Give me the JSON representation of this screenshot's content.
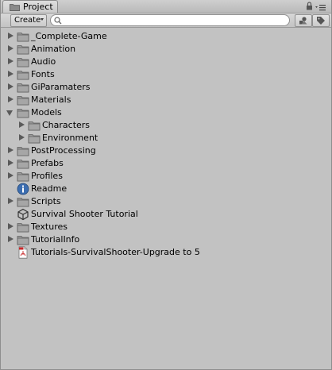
{
  "window": {
    "tab_title": "Project"
  },
  "toolbar": {
    "create_label": "Create",
    "search_value": "",
    "search_placeholder": ""
  },
  "tree": [
    {
      "name": "_Complete-Game",
      "type": "folder",
      "depth": 0,
      "arrow": "collapsed"
    },
    {
      "name": "Animation",
      "type": "folder",
      "depth": 0,
      "arrow": "collapsed"
    },
    {
      "name": "Audio",
      "type": "folder",
      "depth": 0,
      "arrow": "collapsed"
    },
    {
      "name": "Fonts",
      "type": "folder",
      "depth": 0,
      "arrow": "collapsed"
    },
    {
      "name": "GiParamaters",
      "type": "folder",
      "depth": 0,
      "arrow": "collapsed"
    },
    {
      "name": "Materials",
      "type": "folder",
      "depth": 0,
      "arrow": "collapsed"
    },
    {
      "name": "Models",
      "type": "folder",
      "depth": 0,
      "arrow": "expanded"
    },
    {
      "name": "Characters",
      "type": "folder",
      "depth": 1,
      "arrow": "collapsed"
    },
    {
      "name": "Environment",
      "type": "folder",
      "depth": 1,
      "arrow": "collapsed"
    },
    {
      "name": "PostProcessing",
      "type": "folder",
      "depth": 0,
      "arrow": "collapsed"
    },
    {
      "name": "Prefabs",
      "type": "folder",
      "depth": 0,
      "arrow": "collapsed"
    },
    {
      "name": "Profiles",
      "type": "folder",
      "depth": 0,
      "arrow": "collapsed"
    },
    {
      "name": "Readme",
      "type": "info",
      "depth": 0,
      "arrow": "none"
    },
    {
      "name": "Scripts",
      "type": "folder",
      "depth": 0,
      "arrow": "collapsed"
    },
    {
      "name": "Survival Shooter Tutorial",
      "type": "unity",
      "depth": 0,
      "arrow": "none"
    },
    {
      "name": "Textures",
      "type": "folder",
      "depth": 0,
      "arrow": "collapsed"
    },
    {
      "name": "TutorialInfo",
      "type": "folder",
      "depth": 0,
      "arrow": "collapsed"
    },
    {
      "name": "Tutorials-SurvivalShooter-Upgrade to 5",
      "type": "pdf",
      "depth": 0,
      "arrow": "none"
    }
  ]
}
